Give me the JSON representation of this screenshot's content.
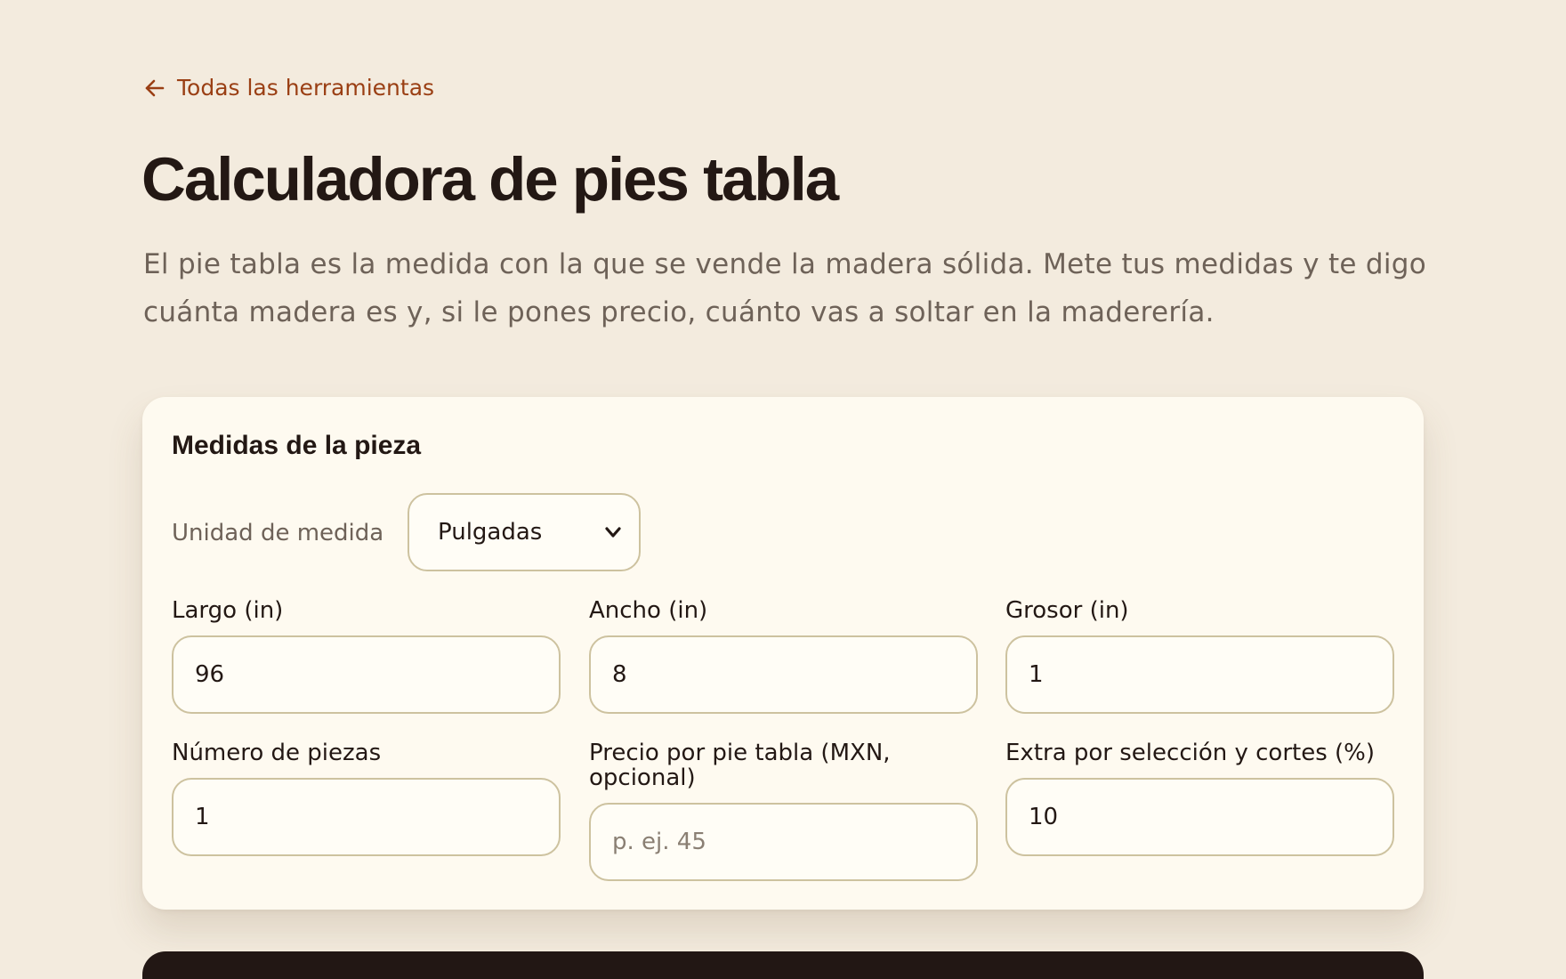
{
  "nav": {
    "back_label": "Todas las herramientas",
    "back_icon": "arrow-left-icon"
  },
  "header": {
    "title": "Calculadora de pies tabla",
    "intro": "El pie tabla es la medida con la que se vende la madera sólida. Mete tus medidas y te digo cuánta madera es y, si le pones precio, cuánto vas a soltar en la maderería."
  },
  "form": {
    "title": "Medidas de la pieza",
    "unit": {
      "label": "Unidad de medida",
      "selected": "Pulgadas"
    },
    "fields": {
      "largo": {
        "label": "Largo (in)",
        "value": "96"
      },
      "ancho": {
        "label": "Ancho (in)",
        "value": "8"
      },
      "grosor": {
        "label": "Grosor (in)",
        "value": "1"
      },
      "piezas": {
        "label": "Número de piezas",
        "value": "1"
      },
      "precio": {
        "label_line1": "Precio por pie tabla (MXN,",
        "label_line2": "opcional)",
        "value": "",
        "placeholder": "p. ej. 45"
      },
      "extra": {
        "label": "Extra por selección y cortes (%)",
        "value": "10"
      }
    }
  },
  "colors": {
    "background": "#f3ebde",
    "accent": "#9a3f14",
    "card": "#fefaf0",
    "border": "#cdc29f",
    "text": "#231814",
    "muted": "#6e6258",
    "dark_panel": "#221714"
  }
}
